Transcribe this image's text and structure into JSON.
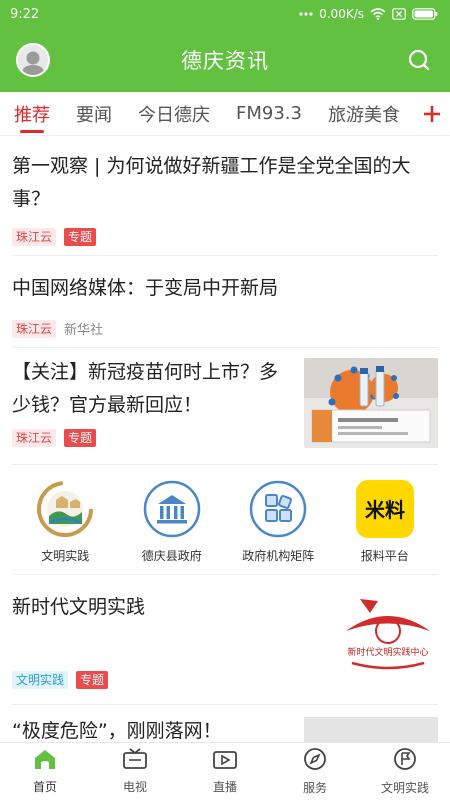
{
  "status_bar": {
    "time": "9:22",
    "network_speed": "0.00K/s"
  },
  "header": {
    "title": "德庆资讯",
    "avatar_icon": "user-avatar-icon",
    "search_icon": "search-icon",
    "brand_color": "#62c140"
  },
  "tabs": [
    {
      "label": "推荐",
      "active": true
    },
    {
      "label": "要闻"
    },
    {
      "label": "今日德庆"
    },
    {
      "label": "FM93.3"
    },
    {
      "label": "旅游美食"
    }
  ],
  "articles": [
    {
      "headline": "第一观察 | 为何说做好新疆工作是全党全国的大事？",
      "source_tag": "珠江云",
      "topic_tag": "专题"
    },
    {
      "headline": "中国网络媒体：于变局中开新局",
      "source_tag": "珠江云",
      "source_text": "新华社"
    },
    {
      "headline": "【关注】新冠疫苗何时上市？多少钱？官方最新回应！",
      "source_tag": "珠江云",
      "topic_tag": "专题"
    }
  ],
  "services": [
    {
      "label": "文明实践",
      "icon": "civilization-practice-icon"
    },
    {
      "label": "德庆县政府",
      "icon": "government-building-icon"
    },
    {
      "label": "政府机构矩阵",
      "icon": "matrix-grid-icon"
    },
    {
      "label": "报料平台",
      "icon": "report-platform-icon",
      "icon_text": "米料"
    }
  ],
  "featured": {
    "headline": "新时代文明实践",
    "source_tag": "文明实践",
    "topic_tag": "专题",
    "thumb_text": "新时代文明实践中心"
  },
  "partial_article": {
    "headline": "“极度危险”，刚刚落网！"
  },
  "bottom_nav": [
    {
      "label": "首页",
      "icon": "home-icon",
      "active": true
    },
    {
      "label": "电视",
      "icon": "tv-icon"
    },
    {
      "label": "直播",
      "icon": "live-video-icon"
    },
    {
      "label": "服务",
      "icon": "compass-icon"
    },
    {
      "label": "文明实践",
      "icon": "flag-icon"
    }
  ],
  "colors": {
    "accent_red": "#e02a2a",
    "brand_green": "#62c140",
    "tag_blue": "#2a9fd8"
  }
}
